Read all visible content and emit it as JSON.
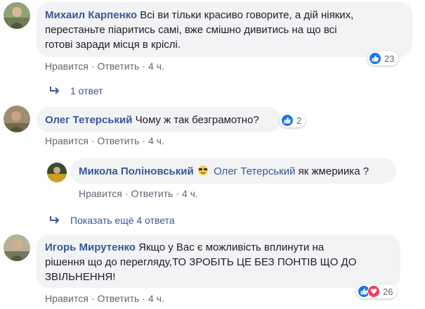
{
  "comments": [
    {
      "author": "Михаил Карпенко",
      "text_lines": [
        "Всі ви тільки красиво говорите, а дій ніяких,",
        "перестаньте піаритись самі, вже смішно дивитись на що всі",
        "готові заради місця в кріслі."
      ],
      "reactions": {
        "count": "23",
        "types": [
          "like-icon"
        ]
      },
      "actions": {
        "like": "Нравится",
        "reply": "Ответить",
        "time": "4 ч."
      },
      "replies_link": "1 ответ"
    },
    {
      "author": "Олег Тетерський",
      "text": "Чому ж так безграмотно?",
      "reactions": {
        "count": "2",
        "types": [
          "like-icon"
        ]
      },
      "actions": {
        "like": "Нравится",
        "reply": "Ответить",
        "time": "4 ч."
      }
    },
    {
      "author": "Микола Поліновський",
      "mention": "Олег Тетерський",
      "text": "як жмериика ?",
      "actions": {
        "like": "Нравится",
        "reply": "Ответить",
        "time": "4 ч."
      },
      "more_replies_link": "Показать ещё 4 ответа"
    },
    {
      "author": "Игорь Мирутенко",
      "text_lines": [
        "Якщо у Вас є можливість вплинути на",
        "рішення що до перегляду,ТО ЗРОБІТЬ ЦЕ БЕЗ ПОНТІВ ЩО ДО",
        "ЗВІЛЬНЕННЯ!"
      ],
      "reactions": {
        "count": "26",
        "types": [
          "like-icon",
          "love-icon"
        ]
      },
      "actions": {
        "like": "Нравится",
        "reply": "Ответить",
        "time": "4 ч."
      }
    }
  ],
  "colors": {
    "link": "#385898",
    "bubble": "#f2f3f5",
    "meta": "#606770",
    "like": "#1877f2",
    "love": "#f33e58"
  }
}
